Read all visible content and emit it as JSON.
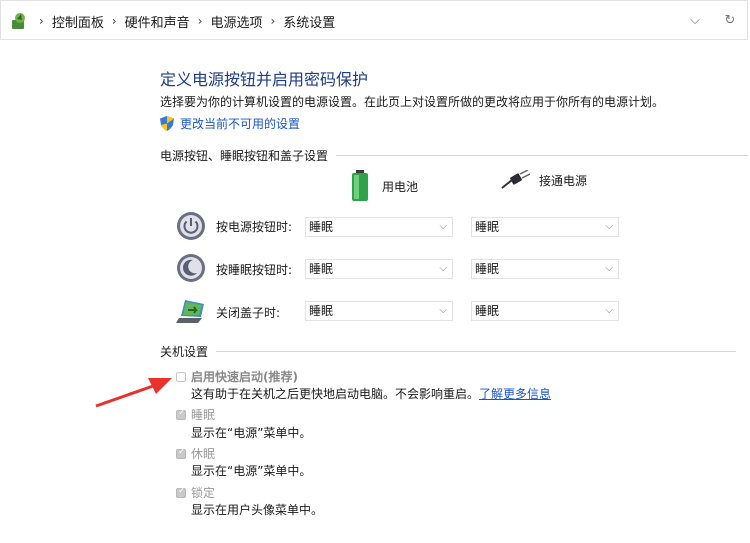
{
  "breadcrumb": [
    "控制面板",
    "硬件和声音",
    "电源选项",
    "系统设置"
  ],
  "icons": {
    "root": "control-panel-icon",
    "dropdown": "chevron-down-icon",
    "refresh": "refresh-icon",
    "shield": "uac-shield-icon",
    "battery": "battery-icon",
    "plug": "plug-icon",
    "power": "power-button-icon",
    "sleep": "sleep-button-icon",
    "lid": "laptop-lid-icon",
    "arrow": "red-arrow-annotation"
  },
  "page": {
    "title": "定义电源按钮并启用密码保护",
    "description": "选择要为你的计算机设置的电源设置。在此页上对设置所做的更改将应用于你所有的电源计划。",
    "admin_link": "更改当前不可用的设置"
  },
  "power_section": {
    "heading": "电源按钮、睡眠按钮和盖子设置",
    "col_battery": "用电池",
    "col_plugged": "接通电源",
    "rows": [
      {
        "label": "按电源按钮时:",
        "battery": "睡眠",
        "plugged": "睡眠"
      },
      {
        "label": "按睡眠按钮时:",
        "battery": "睡眠",
        "plugged": "睡眠"
      },
      {
        "label": "关闭盖子时:",
        "battery": "睡眠",
        "plugged": "睡眠"
      }
    ]
  },
  "shutdown_section": {
    "heading": "关机设置",
    "options": [
      {
        "label": "启用快速启动(推荐)",
        "checked": false,
        "desc": "这有助于在关机之后更快地启动电脑。不会影响重启。",
        "link": "了解更多信息"
      },
      {
        "label": "睡眠",
        "checked": true,
        "desc": "显示在“电源”菜单中。"
      },
      {
        "label": "休眠",
        "checked": true,
        "desc": "显示在“电源”菜单中。"
      },
      {
        "label": "锁定",
        "checked": true,
        "desc": "显示在用户头像菜单中。"
      }
    ]
  },
  "colors": {
    "title": "#1c3d8a",
    "link": "#1a56c8",
    "annotation_arrow": "#e8322b",
    "disabled_text": "#9a9a9a"
  }
}
